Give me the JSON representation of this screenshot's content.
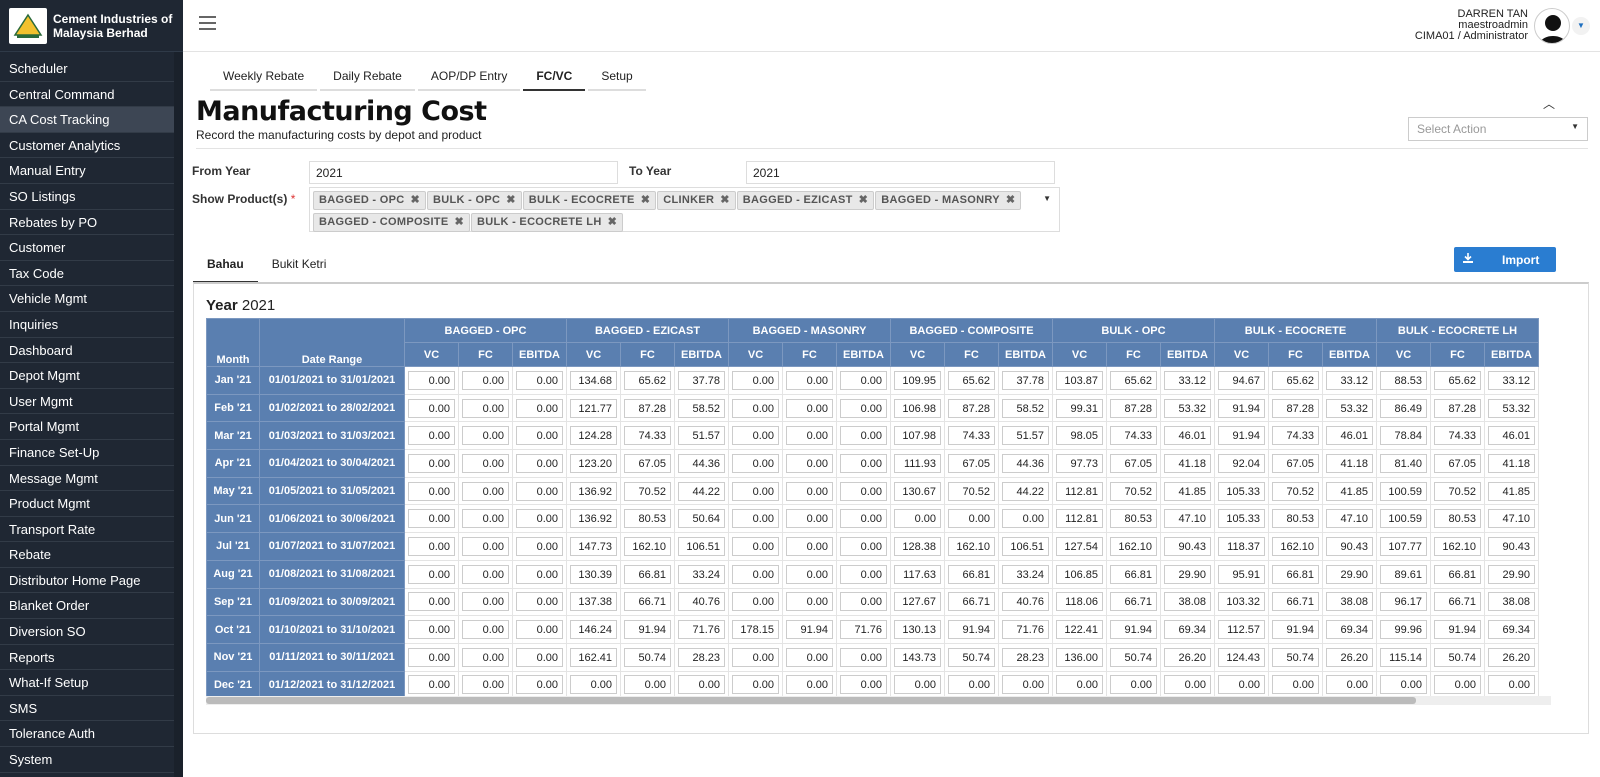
{
  "brand": {
    "name_line1": "Cement Industries of",
    "name_line2": "Malaysia Berhad"
  },
  "sidebar": {
    "items": [
      {
        "label": "Scheduler"
      },
      {
        "label": "Central Command"
      },
      {
        "label": "CA Cost Tracking",
        "active": true
      },
      {
        "label": "Customer Analytics"
      },
      {
        "label": "Manual Entry"
      },
      {
        "label": "SO Listings"
      },
      {
        "label": "Rebates by PO"
      },
      {
        "label": "Customer"
      },
      {
        "label": "Tax Code"
      },
      {
        "label": "Vehicle Mgmt"
      },
      {
        "label": "Inquiries"
      },
      {
        "label": "Dashboard"
      },
      {
        "label": "Depot Mgmt"
      },
      {
        "label": "User Mgmt"
      },
      {
        "label": "Portal Mgmt"
      },
      {
        "label": "Finance Set-Up"
      },
      {
        "label": "Message Mgmt"
      },
      {
        "label": "Product Mgmt"
      },
      {
        "label": "Transport Rate"
      },
      {
        "label": "Rebate"
      },
      {
        "label": "Distributor Home Page"
      },
      {
        "label": "Blanket Order"
      },
      {
        "label": "Diversion SO"
      },
      {
        "label": "Reports"
      },
      {
        "label": "What-If Setup"
      },
      {
        "label": "SMS"
      },
      {
        "label": "Tolerance Auth"
      },
      {
        "label": "System"
      }
    ]
  },
  "user": {
    "name": "DARREN TAN",
    "login": "maestroadmin",
    "role": "CIMA01 / Administrator"
  },
  "top_tabs": [
    {
      "label": "Weekly Rebate"
    },
    {
      "label": "Daily Rebate"
    },
    {
      "label": "AOP/DP Entry"
    },
    {
      "label": "FC/VC",
      "active": true
    },
    {
      "label": "Setup"
    }
  ],
  "page": {
    "title": "Manufacturing Cost",
    "subtitle": "Record the manufacturing costs by depot and product",
    "select_action_placeholder": "Select Action"
  },
  "filters": {
    "from_year_label": "From Year",
    "from_year": "2021",
    "to_year_label": "To Year",
    "to_year": "2021",
    "products_label": "Show Product(s)",
    "required_mark": "*",
    "products": [
      "BAGGED - OPC",
      "BULK - OPC",
      "BULK - ECOCRETE",
      "CLINKER",
      "BAGGED - EZICAST",
      "BAGGED - MASONRY",
      "BAGGED - COMPOSITE",
      "BULK - ECOCRETE LH"
    ]
  },
  "depot_tabs": [
    {
      "label": "Bahau",
      "active": true
    },
    {
      "label": "Bukit Ketri"
    }
  ],
  "import_label": "Import",
  "year": {
    "prefix": "Year",
    "value": "2021"
  },
  "grid": {
    "month_header": "Month",
    "range_header": "Date Range",
    "groups": [
      "BAGGED - OPC",
      "BAGGED - EZICAST",
      "BAGGED - MASONRY",
      "BAGGED - COMPOSITE",
      "BULK - OPC",
      "BULK - ECOCRETE",
      "BULK - ECOCRETE LH"
    ],
    "sub_headers": [
      "VC",
      "FC",
      "EBITDA"
    ],
    "rows": [
      {
        "month": "Jan '21",
        "range": "01/01/2021 to 31/01/2021",
        "values": [
          "0.00",
          "0.00",
          "0.00",
          "134.68",
          "65.62",
          "37.78",
          "0.00",
          "0.00",
          "0.00",
          "109.95",
          "65.62",
          "37.78",
          "103.87",
          "65.62",
          "33.12",
          "94.67",
          "65.62",
          "33.12",
          "88.53",
          "65.62",
          "33.12"
        ]
      },
      {
        "month": "Feb '21",
        "range": "01/02/2021 to 28/02/2021",
        "values": [
          "0.00",
          "0.00",
          "0.00",
          "121.77",
          "87.28",
          "58.52",
          "0.00",
          "0.00",
          "0.00",
          "106.98",
          "87.28",
          "58.52",
          "99.31",
          "87.28",
          "53.32",
          "91.94",
          "87.28",
          "53.32",
          "86.49",
          "87.28",
          "53.32"
        ]
      },
      {
        "month": "Mar '21",
        "range": "01/03/2021 to 31/03/2021",
        "values": [
          "0.00",
          "0.00",
          "0.00",
          "124.28",
          "74.33",
          "51.57",
          "0.00",
          "0.00",
          "0.00",
          "107.98",
          "74.33",
          "51.57",
          "98.05",
          "74.33",
          "46.01",
          "91.94",
          "74.33",
          "46.01",
          "78.84",
          "74.33",
          "46.01"
        ]
      },
      {
        "month": "Apr '21",
        "range": "01/04/2021 to 30/04/2021",
        "values": [
          "0.00",
          "0.00",
          "0.00",
          "123.20",
          "67.05",
          "44.36",
          "0.00",
          "0.00",
          "0.00",
          "111.93",
          "67.05",
          "44.36",
          "97.73",
          "67.05",
          "41.18",
          "92.04",
          "67.05",
          "41.18",
          "81.40",
          "67.05",
          "41.18"
        ]
      },
      {
        "month": "May '21",
        "range": "01/05/2021 to 31/05/2021",
        "values": [
          "0.00",
          "0.00",
          "0.00",
          "136.92",
          "70.52",
          "44.22",
          "0.00",
          "0.00",
          "0.00",
          "130.67",
          "70.52",
          "44.22",
          "112.81",
          "70.52",
          "41.85",
          "105.33",
          "70.52",
          "41.85",
          "100.59",
          "70.52",
          "41.85"
        ]
      },
      {
        "month": "Jun '21",
        "range": "01/06/2021 to 30/06/2021",
        "values": [
          "0.00",
          "0.00",
          "0.00",
          "136.92",
          "80.53",
          "50.64",
          "0.00",
          "0.00",
          "0.00",
          "0.00",
          "0.00",
          "0.00",
          "112.81",
          "80.53",
          "47.10",
          "105.33",
          "80.53",
          "47.10",
          "100.59",
          "80.53",
          "47.10"
        ]
      },
      {
        "month": "Jul '21",
        "range": "01/07/2021 to 31/07/2021",
        "values": [
          "0.00",
          "0.00",
          "0.00",
          "147.73",
          "162.10",
          "106.51",
          "0.00",
          "0.00",
          "0.00",
          "128.38",
          "162.10",
          "106.51",
          "127.54",
          "162.10",
          "90.43",
          "118.37",
          "162.10",
          "90.43",
          "107.77",
          "162.10",
          "90.43"
        ]
      },
      {
        "month": "Aug '21",
        "range": "01/08/2021 to 31/08/2021",
        "values": [
          "0.00",
          "0.00",
          "0.00",
          "130.39",
          "66.81",
          "33.24",
          "0.00",
          "0.00",
          "0.00",
          "117.63",
          "66.81",
          "33.24",
          "106.85",
          "66.81",
          "29.90",
          "95.91",
          "66.81",
          "29.90",
          "89.61",
          "66.81",
          "29.90"
        ]
      },
      {
        "month": "Sep '21",
        "range": "01/09/2021 to 30/09/2021",
        "values": [
          "0.00",
          "0.00",
          "0.00",
          "137.38",
          "66.71",
          "40.76",
          "0.00",
          "0.00",
          "0.00",
          "127.67",
          "66.71",
          "40.76",
          "118.06",
          "66.71",
          "38.08",
          "103.32",
          "66.71",
          "38.08",
          "96.17",
          "66.71",
          "38.08"
        ]
      },
      {
        "month": "Oct '21",
        "range": "01/10/2021 to 31/10/2021",
        "values": [
          "0.00",
          "0.00",
          "0.00",
          "146.24",
          "91.94",
          "71.76",
          "178.15",
          "91.94",
          "71.76",
          "130.13",
          "91.94",
          "71.76",
          "122.41",
          "91.94",
          "69.34",
          "112.57",
          "91.94",
          "69.34",
          "99.96",
          "91.94",
          "69.34"
        ]
      },
      {
        "month": "Nov '21",
        "range": "01/11/2021 to 30/11/2021",
        "values": [
          "0.00",
          "0.00",
          "0.00",
          "162.41",
          "50.74",
          "28.23",
          "0.00",
          "0.00",
          "0.00",
          "143.73",
          "50.74",
          "28.23",
          "136.00",
          "50.74",
          "26.20",
          "124.43",
          "50.74",
          "26.20",
          "115.14",
          "50.74",
          "26.20"
        ]
      },
      {
        "month": "Dec '21",
        "range": "01/12/2021 to 31/12/2021",
        "values": [
          "0.00",
          "0.00",
          "0.00",
          "0.00",
          "0.00",
          "0.00",
          "0.00",
          "0.00",
          "0.00",
          "0.00",
          "0.00",
          "0.00",
          "0.00",
          "0.00",
          "0.00",
          "0.00",
          "0.00",
          "0.00",
          "0.00",
          "0.00",
          "0.00"
        ]
      }
    ]
  },
  "colors": {
    "sidebar_bg": "#1f2733",
    "header_blue": "#5a7fb0",
    "import_btn": "#2a7dd1"
  }
}
